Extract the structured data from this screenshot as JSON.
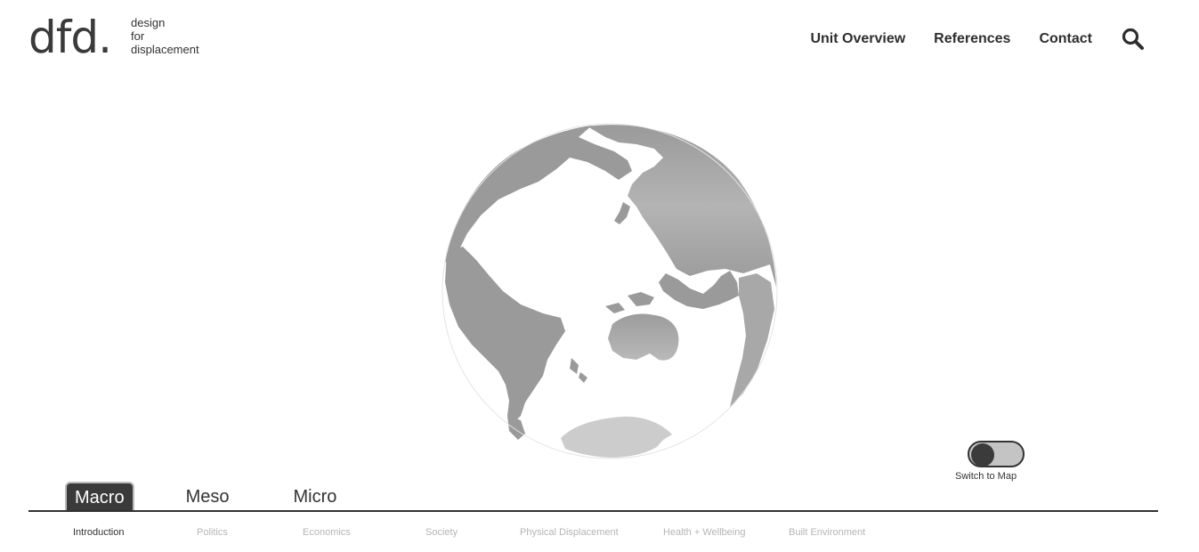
{
  "logo": {
    "mark": "dfd.",
    "line1": "design",
    "line2": "for",
    "line3": "displacement"
  },
  "nav": {
    "items": [
      {
        "label": "Unit Overview"
      },
      {
        "label": "References"
      },
      {
        "label": "Contact"
      }
    ],
    "search_icon": "search-icon"
  },
  "globe": {
    "ocean_color": "#ffffff",
    "land_color": "#9a9a9a",
    "antarctica_color": "#cccccc"
  },
  "toggle": {
    "label": "Switch to Map",
    "state": "off"
  },
  "scale_tabs": {
    "items": [
      {
        "label": "Macro",
        "active": true
      },
      {
        "label": "Meso",
        "active": false
      },
      {
        "label": "Micro",
        "active": false
      }
    ]
  },
  "topic_tabs": {
    "items": [
      {
        "label": "Introduction",
        "active": true
      },
      {
        "label": "Politics",
        "active": false
      },
      {
        "label": "Economics",
        "active": false
      },
      {
        "label": "Society",
        "active": false
      },
      {
        "label": "Physical Displacement",
        "active": false
      },
      {
        "label": "Health + Wellbeing",
        "active": false
      },
      {
        "label": "Built Environment",
        "active": false
      }
    ]
  },
  "colors": {
    "accent_dark": "#3a3a3a",
    "inactive_text": "#b5b5b5"
  }
}
